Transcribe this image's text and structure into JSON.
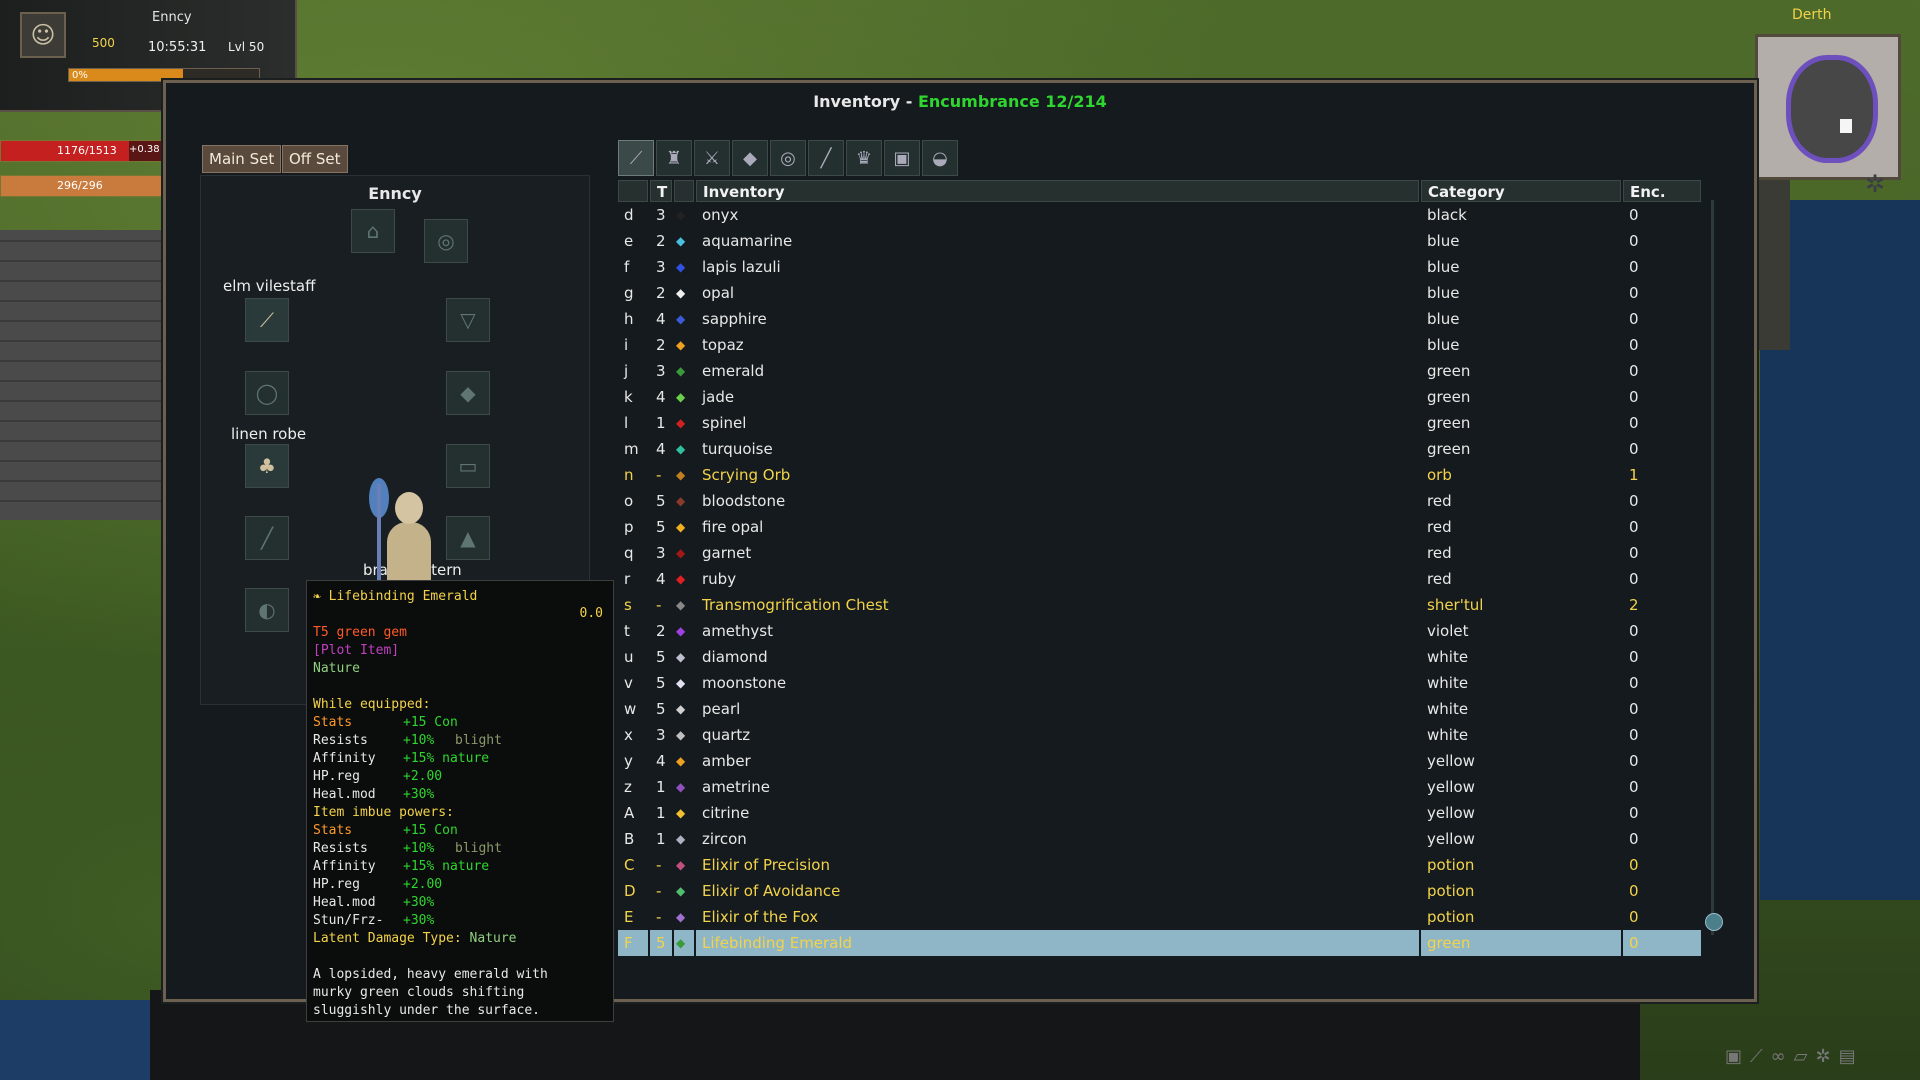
{
  "hud": {
    "name": "Enncy",
    "gold": "500",
    "time": "10:55:31",
    "level": "Lvl 50",
    "xp_text": "0%",
    "xp_fraction": 0.6,
    "hp": "1176/1513",
    "hp_regen": "+0.38",
    "hp_fraction": 0.777,
    "resource": "296/296",
    "resource_fraction": 1.0,
    "colors": {
      "hp": "#c42020",
      "resource": "#c97b3e",
      "gold": "#f3d34a"
    }
  },
  "minimap": {
    "title": "Derth"
  },
  "window": {
    "title_prefix": "Inventory - ",
    "title_encumbrance": "Encumbrance 12/214"
  },
  "equipment": {
    "main_set_label": "Main Set",
    "off_set_label": "Off Set",
    "character_name": "Enncy",
    "weapon_label": "elm vilestaff",
    "body_label": "linen robe",
    "light_label": "brass lantern"
  },
  "tabs": [
    {
      "icon": "all-items-icon"
    },
    {
      "icon": "armor-icon"
    },
    {
      "icon": "weapon-icon"
    },
    {
      "icon": "gem-icon"
    },
    {
      "icon": "ring-icon"
    },
    {
      "icon": "wand-icon"
    },
    {
      "icon": "trophy-icon"
    },
    {
      "icon": "chest-icon"
    },
    {
      "icon": "bag-icon"
    }
  ],
  "table": {
    "headers": {
      "tier": "T",
      "name": "Inventory",
      "category": "Category",
      "enc": "Enc."
    },
    "rows": [
      {
        "letter": "d",
        "tier": "3",
        "icon_color": "#222",
        "name": "onyx",
        "category": "black",
        "enc": "0",
        "highlight": false
      },
      {
        "letter": "e",
        "tier": "2",
        "icon_color": "#4ac0e0",
        "name": "aquamarine",
        "category": "blue",
        "enc": "0",
        "highlight": false
      },
      {
        "letter": "f",
        "tier": "3",
        "icon_color": "#3050e0",
        "name": "lapis lazuli",
        "category": "blue",
        "enc": "0",
        "highlight": false
      },
      {
        "letter": "g",
        "tier": "2",
        "icon_color": "#f0f0f0",
        "name": "opal",
        "category": "blue",
        "enc": "0",
        "highlight": false
      },
      {
        "letter": "h",
        "tier": "4",
        "icon_color": "#3a5ad8",
        "name": "sapphire",
        "category": "blue",
        "enc": "0",
        "highlight": false
      },
      {
        "letter": "i",
        "tier": "2",
        "icon_color": "#f0a020",
        "name": "topaz",
        "category": "blue",
        "enc": "0",
        "highlight": false
      },
      {
        "letter": "j",
        "tier": "3",
        "icon_color": "#3a9a3a",
        "name": "emerald",
        "category": "green",
        "enc": "0",
        "highlight": false
      },
      {
        "letter": "k",
        "tier": "4",
        "icon_color": "#6ad04a",
        "name": "jade",
        "category": "green",
        "enc": "0",
        "highlight": false
      },
      {
        "letter": "l",
        "tier": "1",
        "icon_color": "#d02020",
        "name": "spinel",
        "category": "green",
        "enc": "0",
        "highlight": false
      },
      {
        "letter": "m",
        "tier": "4",
        "icon_color": "#30c0a0",
        "name": "turquoise",
        "category": "green",
        "enc": "0",
        "highlight": false
      },
      {
        "letter": "n",
        "tier": "-",
        "icon_color": "#c08020",
        "name": "Scrying Orb",
        "category": "orb",
        "enc": "1",
        "highlight": true
      },
      {
        "letter": "o",
        "tier": "5",
        "icon_color": "#8a3a2a",
        "name": "bloodstone",
        "category": "red",
        "enc": "0",
        "highlight": false
      },
      {
        "letter": "p",
        "tier": "5",
        "icon_color": "#f0b020",
        "name": "fire opal",
        "category": "red",
        "enc": "0",
        "highlight": false
      },
      {
        "letter": "q",
        "tier": "3",
        "icon_color": "#a01818",
        "name": "garnet",
        "category": "red",
        "enc": "0",
        "highlight": false
      },
      {
        "letter": "r",
        "tier": "4",
        "icon_color": "#e02020",
        "name": "ruby",
        "category": "red",
        "enc": "0",
        "highlight": false
      },
      {
        "letter": "s",
        "tier": "-",
        "icon_color": "#888",
        "name": "Transmogrification Chest",
        "category": "sher'tul",
        "enc": "2",
        "highlight": true
      },
      {
        "letter": "t",
        "tier": "2",
        "icon_color": "#a040e0",
        "name": "amethyst",
        "category": "violet",
        "enc": "0",
        "highlight": false
      },
      {
        "letter": "u",
        "tier": "5",
        "icon_color": "#c0c0d0",
        "name": "diamond",
        "category": "white",
        "enc": "0",
        "highlight": false
      },
      {
        "letter": "v",
        "tier": "5",
        "icon_color": "#e0e0f0",
        "name": "moonstone",
        "category": "white",
        "enc": "0",
        "highlight": false
      },
      {
        "letter": "w",
        "tier": "5",
        "icon_color": "#d0d0d0",
        "name": "pearl",
        "category": "white",
        "enc": "0",
        "highlight": false
      },
      {
        "letter": "x",
        "tier": "3",
        "icon_color": "#c0c0c0",
        "name": "quartz",
        "category": "white",
        "enc": "0",
        "highlight": false
      },
      {
        "letter": "y",
        "tier": "4",
        "icon_color": "#f0a020",
        "name": "amber",
        "category": "yellow",
        "enc": "0",
        "highlight": false
      },
      {
        "letter": "z",
        "tier": "1",
        "icon_color": "#9050c0",
        "name": "ametrine",
        "category": "yellow",
        "enc": "0",
        "highlight": false
      },
      {
        "letter": "A",
        "tier": "1",
        "icon_color": "#f0c030",
        "name": "citrine",
        "category": "yellow",
        "enc": "0",
        "highlight": false
      },
      {
        "letter": "B",
        "tier": "1",
        "icon_color": "#b0b0c0",
        "name": "zircon",
        "category": "yellow",
        "enc": "0",
        "highlight": false
      },
      {
        "letter": "C",
        "tier": "-",
        "icon_color": "#c05080",
        "name": "Elixir of Precision",
        "category": "potion",
        "enc": "0",
        "highlight": true
      },
      {
        "letter": "D",
        "tier": "-",
        "icon_color": "#50c070",
        "name": "Elixir of Avoidance",
        "category": "potion",
        "enc": "0",
        "highlight": true
      },
      {
        "letter": "E",
        "tier": "-",
        "icon_color": "#a070d0",
        "name": "Elixir of the Fox",
        "category": "potion",
        "enc": "0",
        "highlight": true
      },
      {
        "letter": "F",
        "tier": "5",
        "icon_color": "#3a9a3a",
        "name": "Lifebinding Emerald",
        "category": "green",
        "enc": "0",
        "highlight": true,
        "selected": true
      }
    ]
  },
  "tooltip": {
    "title": "Lifebinding Emerald",
    "weight": "0.0",
    "tier_line": "T5 green gem",
    "plot_line": "[Plot Item]",
    "school_line": "Nature",
    "equipped_head": "While equipped:",
    "equipped": [
      {
        "key": "Stats",
        "val": "+15 Con",
        "extra": ""
      },
      {
        "key": "Resists",
        "val": "+10%",
        "extra": "blight"
      },
      {
        "key": "Affinity",
        "val": "+15% nature",
        "extra": ""
      },
      {
        "key": "HP.reg",
        "val": "+2.00",
        "extra": ""
      },
      {
        "key": "Heal.mod",
        "val": "+30%",
        "extra": ""
      }
    ],
    "imbue_head": "Item imbue powers:",
    "imbue": [
      {
        "key": "Stats",
        "val": "+15 Con",
        "extra": ""
      },
      {
        "key": "Resists",
        "val": "+10%",
        "extra": "blight"
      },
      {
        "key": "Affinity",
        "val": "+15% nature",
        "extra": ""
      },
      {
        "key": "HP.reg",
        "val": "+2.00",
        "extra": ""
      },
      {
        "key": "Heal.mod",
        "val": "+30%",
        "extra": ""
      },
      {
        "key": "Stun/Frz-",
        "val": "+30%",
        "extra": ""
      }
    ],
    "latent_label": "Latent Damage Type:",
    "latent_value": "Nature",
    "desc1": "A lopsided, heavy emerald with",
    "desc2": "murky green clouds shifting",
    "desc3": "sluggishly under the surface."
  }
}
